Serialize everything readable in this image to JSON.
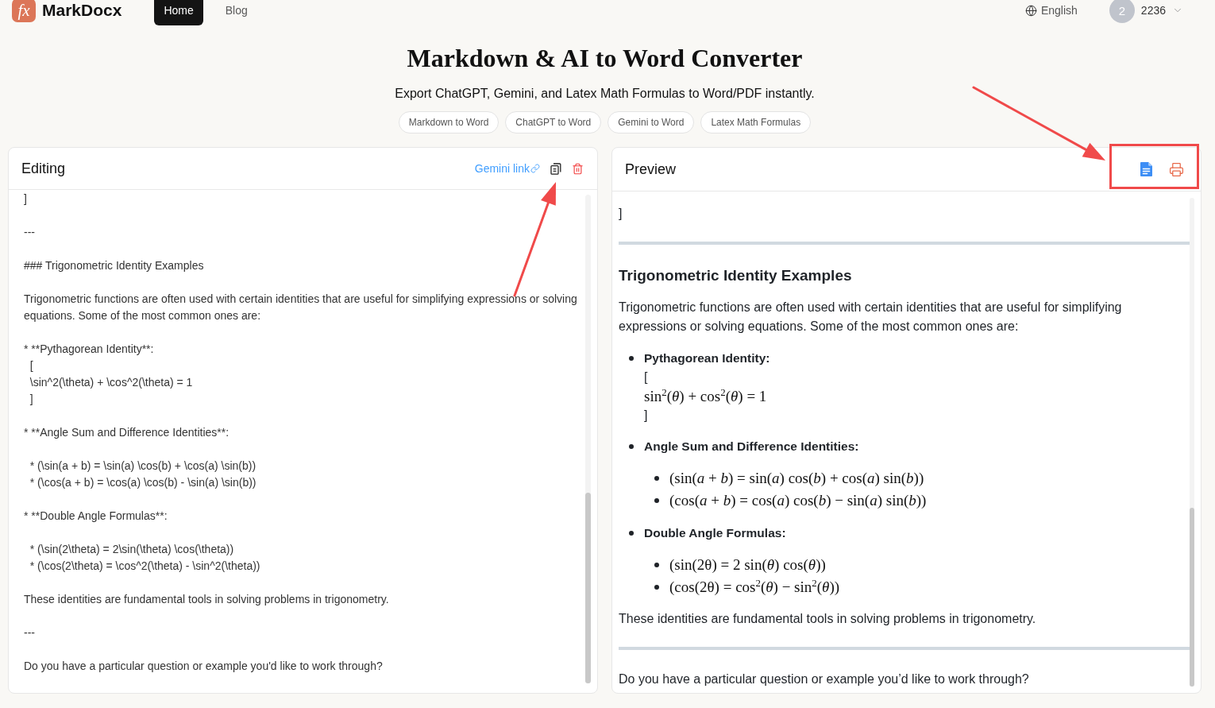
{
  "nav": {
    "logo_mark": "fx",
    "brand": "MarkDocx",
    "links": [
      {
        "label": "Home",
        "selected": true
      },
      {
        "label": "Blog",
        "selected": false
      }
    ],
    "language": "English",
    "user": {
      "avatar": "2",
      "credits": "2236"
    }
  },
  "hero": {
    "title": "Markdown & AI to Word Converter",
    "subtitle": "Export ChatGPT, Gemini, and Latex Math Formulas to Word/PDF instantly.",
    "chips": [
      "Markdown to Word",
      "ChatGPT to Word",
      "Gemini to Word",
      "Latex Math Formulas"
    ]
  },
  "editor": {
    "title": "Editing",
    "link": "Gemini link",
    "blocks": [
      [
        "]"
      ],
      [
        "---"
      ],
      [
        "### Trigonometric Identity Examples"
      ],
      [
        "Trigonometric functions are often used with certain identities that are useful for simplifying expressions or solving equations. Some of the most common ones are:"
      ],
      [
        "* **Pythagorean Identity**:",
        "  [",
        "  \\sin^2(\\theta) + \\cos^2(\\theta) = 1",
        "  ]"
      ],
      [
        "* **Angle Sum and Difference Identities**:"
      ],
      [
        "  * (\\sin(a + b) = \\sin(a) \\cos(b) + \\cos(a) \\sin(b))",
        "  * (\\cos(a + b) = \\cos(a) \\cos(b) - \\sin(a) \\sin(b))"
      ],
      [
        "* **Double Angle Formulas**:"
      ],
      [
        "  * (\\sin(2\\theta) = 2\\sin(\\theta) \\cos(\\theta))",
        "  * (\\cos(2\\theta) = \\cos^2(\\theta) - \\sin^2(\\theta))"
      ],
      [
        "These identities are fundamental tools in solving problems in trigonometry."
      ],
      [
        "---"
      ],
      [
        "Do you have a particular question or example you'd like to work through?"
      ]
    ]
  },
  "preview": {
    "title": "Preview",
    "blocks": [
      {
        "kind": "text",
        "text": "]"
      },
      {
        "kind": "rule"
      },
      {
        "kind": "heading",
        "text": "Trigonometric Identity Examples"
      },
      {
        "kind": "paragraph",
        "text": "Trigonometric functions are often used with certain identities that are useful for simplifying expressions or solving equations. Some of the most common ones are:"
      },
      {
        "kind": "list",
        "items": [
          {
            "label": "Pythagorean Identity:",
            "lines": [
              {
                "kind": "text",
                "text": "["
              },
              {
                "kind": "math",
                "text": "sin$^{2}$(*θ*) + cos$^{2}$(*θ*) = 1"
              },
              {
                "kind": "text",
                "text": "]"
              }
            ]
          },
          {
            "label": "Angle Sum and Difference Identities:",
            "children": [
              "(sin(*a* + *b*) = sin(*a*) cos(*b*) + cos(*a*) sin(*b*))",
              "(cos(*a* + *b*) = cos(*a*) cos(*b*) − sin(*a*) sin(*b*))"
            ]
          },
          {
            "label": "Double Angle Formulas:",
            "children": [
              "(sin(2θ) = 2 sin(*θ*) cos(*θ*))",
              "(cos(2θ) = cos$^{2}$(*θ*) − sin$^{2}$(*θ*))"
            ]
          }
        ]
      },
      {
        "kind": "paragraph",
        "text": "These identities are fundamental tools in solving problems in trigonometry."
      },
      {
        "kind": "rule"
      },
      {
        "kind": "paragraph",
        "text": "Do you have a particular question or example you’d like to work through?"
      }
    ]
  }
}
